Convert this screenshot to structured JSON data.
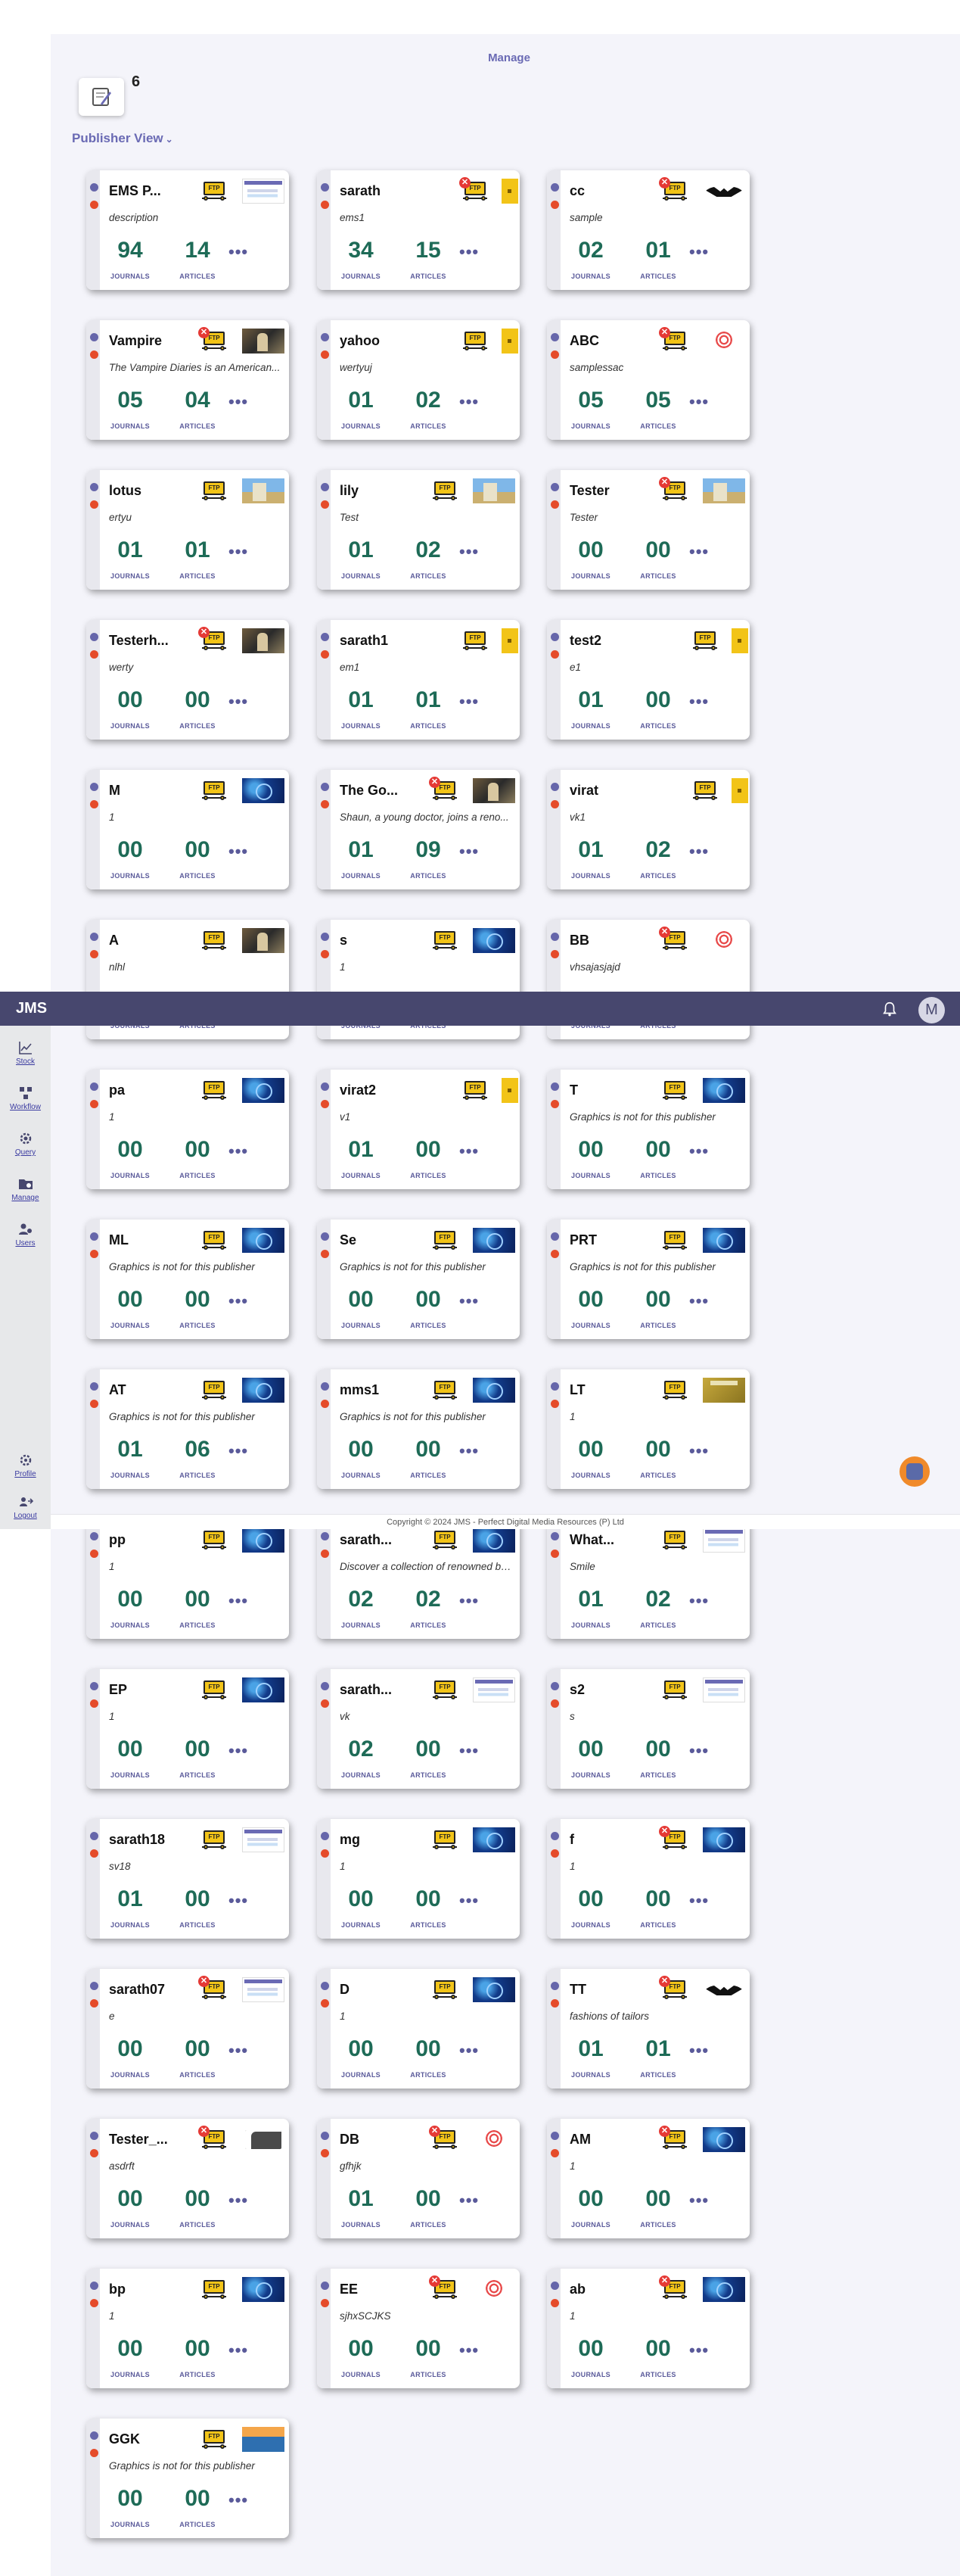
{
  "header": {
    "app_title": "JMS",
    "avatar_initial": "M"
  },
  "sidebar": {
    "items": [
      {
        "label": "Stock",
        "icon": "chart-line-icon"
      },
      {
        "label": "Workflow",
        "icon": "workflow-icon"
      },
      {
        "label": "Query",
        "icon": "query-gear-icon"
      },
      {
        "label": "Manage",
        "icon": "folder-gear-icon"
      },
      {
        "label": "Users",
        "icon": "users-gear-icon"
      }
    ],
    "bottom": [
      {
        "label": "Profile",
        "icon": "profile-gear-icon"
      },
      {
        "label": "Logout",
        "icon": "logout-icon"
      }
    ]
  },
  "main": {
    "title": "Manage",
    "count": "6",
    "view_toggle": "Publisher View",
    "labels": {
      "journals": "JOURNALS",
      "articles": "ARTICLES",
      "more": "•••"
    }
  },
  "publishers": [
    {
      "name": "EMS P...",
      "desc": "description",
      "journals": "94",
      "articles": "14",
      "ftp_error": false,
      "thumb": "screen"
    },
    {
      "name": "sarath",
      "desc": "ems1",
      "journals": "34",
      "articles": "15",
      "ftp_error": true,
      "thumb": "yellow"
    },
    {
      "name": "cc",
      "desc": "sample",
      "journals": "02",
      "articles": "01",
      "ftp_error": true,
      "thumb": "batwing"
    },
    {
      "name": "Vampire",
      "desc": "The Vampire Diaries is an American...",
      "journals": "05",
      "articles": "04",
      "ftp_error": true,
      "thumb": "dark"
    },
    {
      "name": "yahoo",
      "desc": "wertyuj",
      "journals": "01",
      "articles": "02",
      "ftp_error": false,
      "thumb": "yellow"
    },
    {
      "name": "ABC",
      "desc": "samplessac",
      "journals": "05",
      "articles": "05",
      "ftp_error": true,
      "thumb": "swirl"
    },
    {
      "name": "lotus",
      "desc": "ertyu",
      "journals": "01",
      "articles": "01",
      "ftp_error": false,
      "thumb": "photo"
    },
    {
      "name": "lily",
      "desc": "Test",
      "journals": "01",
      "articles": "02",
      "ftp_error": false,
      "thumb": "photo"
    },
    {
      "name": "Tester",
      "desc": "Tester",
      "journals": "00",
      "articles": "00",
      "ftp_error": true,
      "thumb": "photo"
    },
    {
      "name": "Testerh...",
      "desc": "werty",
      "journals": "00",
      "articles": "00",
      "ftp_error": true,
      "thumb": "dark"
    },
    {
      "name": "sarath1",
      "desc": "em1",
      "journals": "01",
      "articles": "01",
      "ftp_error": false,
      "thumb": "yellow"
    },
    {
      "name": "test2",
      "desc": "e1",
      "journals": "01",
      "articles": "00",
      "ftp_error": false,
      "thumb": "yellow"
    },
    {
      "name": "M",
      "desc": "1",
      "journals": "00",
      "articles": "00",
      "ftp_error": false,
      "thumb": "blue"
    },
    {
      "name": "The Go...",
      "desc": "Shaun, a young doctor, joins a reno...",
      "journals": "01",
      "articles": "09",
      "ftp_error": true,
      "thumb": "dark"
    },
    {
      "name": "virat",
      "desc": "vk1",
      "journals": "01",
      "articles": "02",
      "ftp_error": false,
      "thumb": "yellow"
    },
    {
      "name": "A",
      "desc": "nlhl",
      "journals": "",
      "articles": "",
      "ftp_error": false,
      "thumb": "dark"
    },
    {
      "name": "s",
      "desc": "1",
      "journals": "",
      "articles": "",
      "ftp_error": false,
      "thumb": "blue"
    },
    {
      "name": "BB",
      "desc": "vhsajasjajd",
      "journals": "",
      "articles": "",
      "ftp_error": true,
      "thumb": "swirl"
    },
    {
      "name": "pa",
      "desc": "1",
      "journals": "00",
      "articles": "00",
      "ftp_error": false,
      "thumb": "blue"
    },
    {
      "name": "virat2",
      "desc": "v1",
      "journals": "01",
      "articles": "00",
      "ftp_error": false,
      "thumb": "yellow"
    },
    {
      "name": "T",
      "desc": "Graphics is not for this publisher",
      "journals": "00",
      "articles": "00",
      "ftp_error": false,
      "thumb": "blue"
    },
    {
      "name": "ML",
      "desc": "Graphics is not for this publisher",
      "journals": "00",
      "articles": "00",
      "ftp_error": false,
      "thumb": "blue"
    },
    {
      "name": "Se",
      "desc": "Graphics is not for this publisher",
      "journals": "00",
      "articles": "00",
      "ftp_error": false,
      "thumb": "blue"
    },
    {
      "name": "PRT",
      "desc": "Graphics is not for this publisher",
      "journals": "00",
      "articles": "00",
      "ftp_error": false,
      "thumb": "blue"
    },
    {
      "name": "AT",
      "desc": "Graphics is not for this publisher",
      "journals": "01",
      "articles": "06",
      "ftp_error": false,
      "thumb": "blue"
    },
    {
      "name": "mms1",
      "desc": "Graphics is not for this publisher",
      "journals": "00",
      "articles": "00",
      "ftp_error": false,
      "thumb": "blue"
    },
    {
      "name": "LT",
      "desc": "1",
      "journals": "00",
      "articles": "00",
      "ftp_error": false,
      "thumb": "gold"
    },
    {
      "name": "pp",
      "desc": "1",
      "journals": "00",
      "articles": "00",
      "ftp_error": false,
      "thumb": "blue"
    },
    {
      "name": "sarath...",
      "desc": "Discover a collection of renowned br...",
      "journals": "02",
      "articles": "02",
      "ftp_error": false,
      "thumb": "blue"
    },
    {
      "name": "What...",
      "desc": "Smile",
      "journals": "01",
      "articles": "02",
      "ftp_error": false,
      "thumb": "screen"
    },
    {
      "name": "EP",
      "desc": "1",
      "journals": "00",
      "articles": "00",
      "ftp_error": false,
      "thumb": "blue"
    },
    {
      "name": "sarath...",
      "desc": "vk",
      "journals": "02",
      "articles": "00",
      "ftp_error": false,
      "thumb": "screen"
    },
    {
      "name": "s2",
      "desc": "s",
      "journals": "00",
      "articles": "00",
      "ftp_error": false,
      "thumb": "screen"
    },
    {
      "name": "sarath18",
      "desc": "sv18",
      "journals": "01",
      "articles": "00",
      "ftp_error": false,
      "thumb": "screen"
    },
    {
      "name": "mg",
      "desc": "1",
      "journals": "00",
      "articles": "00",
      "ftp_error": false,
      "thumb": "blue"
    },
    {
      "name": "f",
      "desc": "1",
      "journals": "00",
      "articles": "00",
      "ftp_error": true,
      "thumb": "blue"
    },
    {
      "name": "sarath07",
      "desc": "e",
      "journals": "00",
      "articles": "00",
      "ftp_error": true,
      "thumb": "screen"
    },
    {
      "name": "D",
      "desc": "1",
      "journals": "00",
      "articles": "00",
      "ftp_error": false,
      "thumb": "blue"
    },
    {
      "name": "TT",
      "desc": "fashions of tailors",
      "journals": "01",
      "articles": "01",
      "ftp_error": true,
      "thumb": "batwing"
    },
    {
      "name": "Tester_...",
      "desc": "asdrft",
      "journals": "00",
      "articles": "00",
      "ftp_error": true,
      "thumb": "device"
    },
    {
      "name": "DB",
      "desc": "gfhjk",
      "journals": "01",
      "articles": "00",
      "ftp_error": true,
      "thumb": "swirl"
    },
    {
      "name": "AM",
      "desc": "1",
      "journals": "00",
      "articles": "00",
      "ftp_error": true,
      "thumb": "blue"
    },
    {
      "name": "bp",
      "desc": "1",
      "journals": "00",
      "articles": "00",
      "ftp_error": false,
      "thumb": "blue"
    },
    {
      "name": "EE",
      "desc": "sjhxSCJKS",
      "journals": "00",
      "articles": "00",
      "ftp_error": true,
      "thumb": "swirl"
    },
    {
      "name": "ab",
      "desc": "1",
      "journals": "00",
      "articles": "00",
      "ftp_error": true,
      "thumb": "blue"
    },
    {
      "name": "GGK",
      "desc": "Graphics is not for this publisher",
      "journals": "00",
      "articles": "00",
      "ftp_error": false,
      "thumb": "sunset"
    }
  ],
  "footer": {
    "text": "Copyright © 2024 JMS - Perfect Digital Media Resources (P) Ltd"
  },
  "colors": {
    "accent": "#47476e",
    "number": "#1e6b57",
    "danger": "#e53935",
    "ftp": "#f2c418",
    "fab": "#f08a2a"
  }
}
